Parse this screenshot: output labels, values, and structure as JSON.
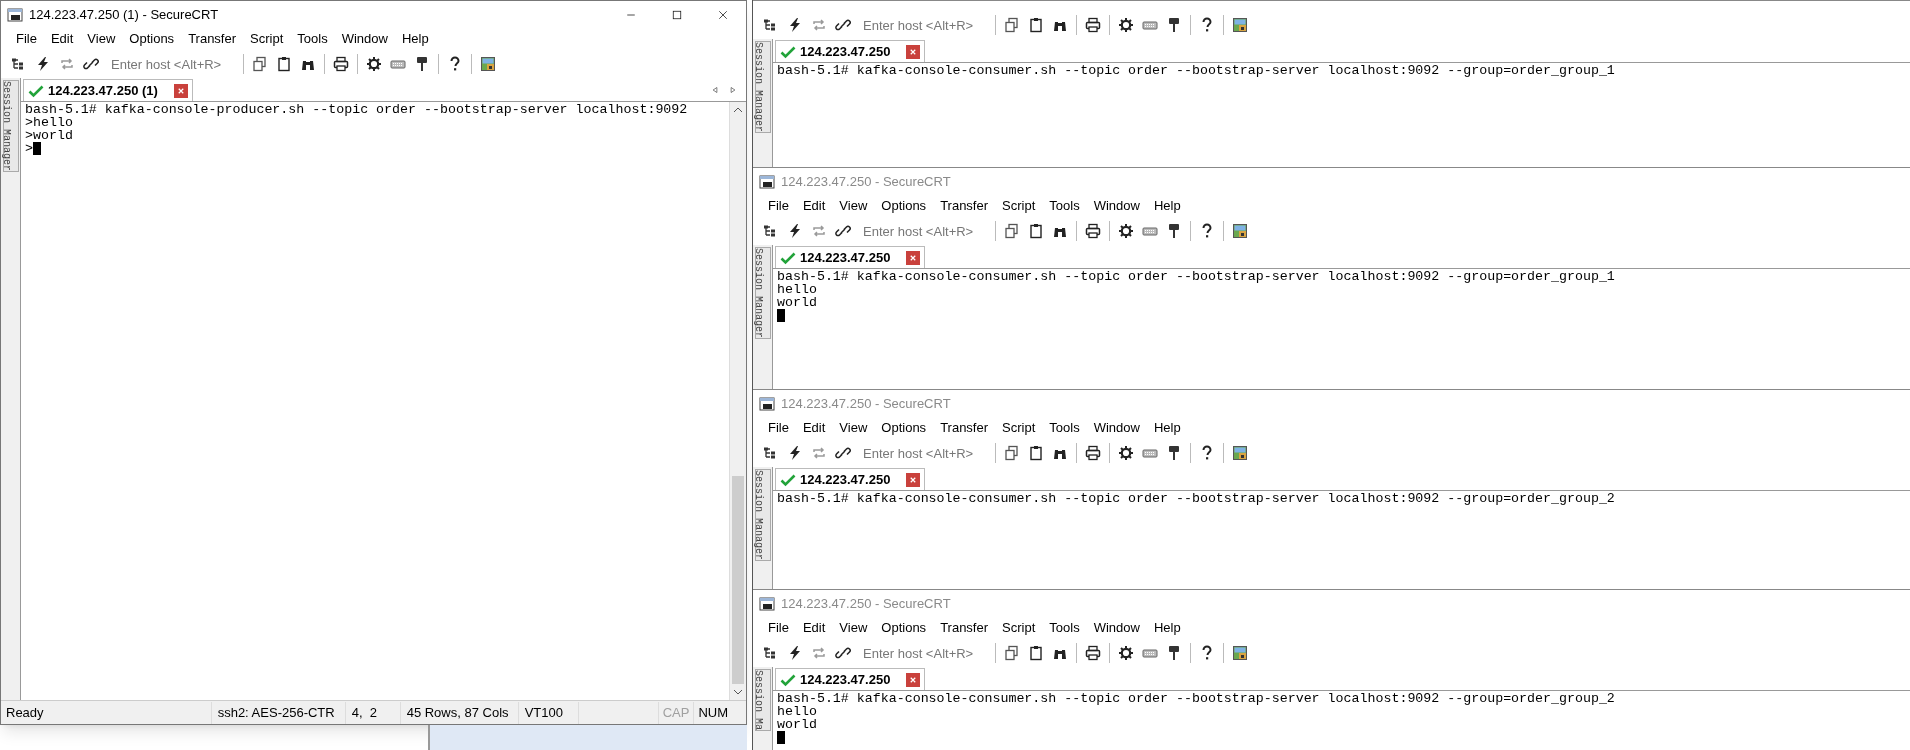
{
  "windows": [
    {
      "active": true,
      "title": "124.223.47.250 (1) - SecureCRT",
      "menu": [
        "File",
        "Edit",
        "View",
        "Options",
        "Transfer",
        "Script",
        "Tools",
        "Window",
        "Help"
      ],
      "host_placeholder": "Enter host <Alt+R>",
      "side_tab": "Session Manager",
      "tab": {
        "label": "124.223.47.250 (1)",
        "connected": true,
        "selected": true
      },
      "terminal": {
        "lines": [
          {
            "text": "bash-5.1# kafka-console-producer.sh --topic order --bootstrap-server localhost:9092"
          },
          {
            "text": ">hello"
          },
          {
            "text": ">world"
          },
          {
            "text": ">",
            "cursor": true
          }
        ]
      },
      "status_bar": {
        "message": "Ready",
        "cells": [
          "ssh2: AES-256-CTR",
          "4,  2",
          "45 Rows, 87 Cols",
          "VT100"
        ],
        "indicators": [
          {
            "label": "CAP",
            "on": false
          },
          {
            "label": "NUM",
            "on": true
          }
        ]
      }
    },
    {
      "host_placeholder": "Enter host <Alt+R>",
      "side_tab": "Session Manager",
      "tab": {
        "label": "124.223.47.250",
        "connected": true,
        "selected": true
      },
      "terminal": {
        "lines": [
          {
            "text": "bash-5.1# kafka-console-consumer.sh --topic order --bootstrap-server localhost:9092 --group=order_group_1"
          }
        ]
      }
    },
    {
      "active": false,
      "title": "124.223.47.250 - SecureCRT",
      "menu": [
        "File",
        "Edit",
        "View",
        "Options",
        "Transfer",
        "Script",
        "Tools",
        "Window",
        "Help"
      ],
      "host_placeholder": "Enter host <Alt+R>",
      "side_tab": "Session Manager",
      "tab": {
        "label": "124.223.47.250",
        "connected": true,
        "selected": true
      },
      "terminal": {
        "lines": [
          {
            "text": "bash-5.1# kafka-console-consumer.sh --topic order --bootstrap-server localhost:9092 --group=order_group_1"
          },
          {
            "text": "hello"
          },
          {
            "text": "world"
          },
          {
            "cursor": true
          }
        ]
      }
    },
    {
      "active": false,
      "title": "124.223.47.250 - SecureCRT",
      "menu": [
        "File",
        "Edit",
        "View",
        "Options",
        "Transfer",
        "Script",
        "Tools",
        "Window",
        "Help"
      ],
      "host_placeholder": "Enter host <Alt+R>",
      "side_tab": "Session Manager",
      "tab": {
        "label": "124.223.47.250",
        "connected": true,
        "selected": true
      },
      "terminal": {
        "lines": [
          {
            "text": "bash-5.1# kafka-console-consumer.sh --topic order --bootstrap-server localhost:9092 --group=order_group_2"
          }
        ]
      }
    },
    {
      "active": false,
      "title": "124.223.47.250 - SecureCRT",
      "menu": [
        "File",
        "Edit",
        "View",
        "Options",
        "Transfer",
        "Script",
        "Tools",
        "Window",
        "Help"
      ],
      "host_placeholder": "Enter host <Alt+R>",
      "side_tab": "Session Ma",
      "tab": {
        "label": "124.223.47.250",
        "connected": true,
        "selected": true
      },
      "terminal": {
        "lines": [
          {
            "text": "bash-5.1# kafka-console-consumer.sh --topic order --bootstrap-server localhost:9092 --group=order_group_2"
          },
          {
            "text": "hello"
          },
          {
            "text": "world"
          },
          {
            "cursor": true
          }
        ]
      }
    }
  ]
}
